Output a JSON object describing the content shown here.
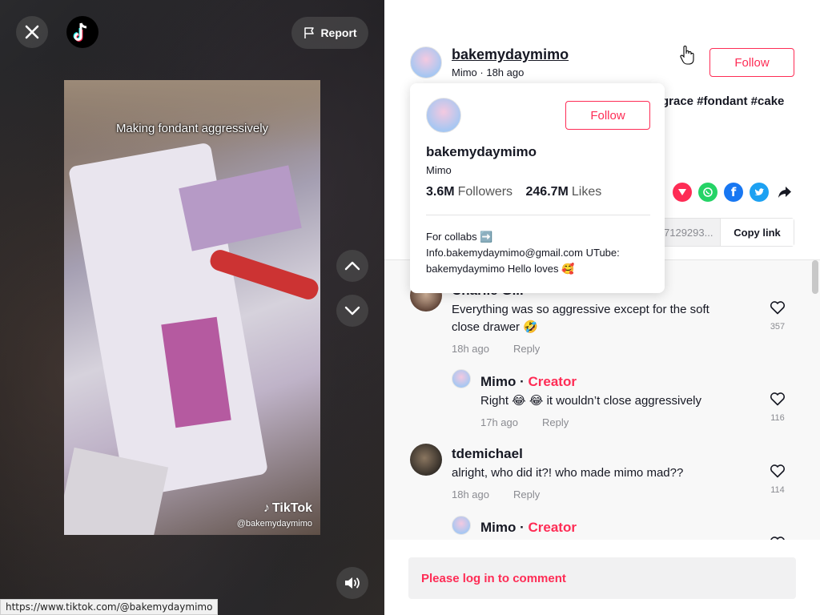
{
  "video": {
    "caption": "Making fondant aggressively",
    "watermark_brand": "TikTok",
    "watermark_handle": "@bakemydaymimo",
    "report_label": "Report"
  },
  "status_bar": {
    "url": "https://www.tiktok.com/@bakemydaymimo"
  },
  "author": {
    "username": "bakemydaymimo",
    "nickname": "Mimo",
    "posted": "18h ago",
    "follow_label": "Follow",
    "description_visible": "grace #fondant #cake"
  },
  "popover": {
    "username": "bakemydaymimo",
    "nickname": "Mimo",
    "follow_label": "Follow",
    "followers_count": "3.6M",
    "followers_label": "Followers",
    "likes_count": "246.7M",
    "likes_label": "Likes",
    "bio_line1": "For collabs ➡️",
    "bio_line2": "Info.bakemydaymimo@gmail.com UTube:",
    "bio_line3": "bakemydaymimo Hello loves 🥰"
  },
  "share": {
    "icons": [
      "pin-icon",
      "whatsapp-icon",
      "facebook-icon",
      "twitter-icon",
      "share-arrow-icon"
    ],
    "link_text": "7129293...",
    "copy_label": "Copy link"
  },
  "comments": [
    {
      "name": "Charlie Gill",
      "text": "Everything was so aggressive except for the soft close drawer 🤣",
      "time": "18h ago",
      "reply": "Reply",
      "likes": "357"
    },
    {
      "name": "Mimo",
      "creator": "Creator",
      "text": "Right 😂 😂 it wouldn’t close aggressively",
      "time": "17h ago",
      "reply": "Reply",
      "likes": "116"
    },
    {
      "name": "tdemichael",
      "text": "alright, who did it?! who made mimo mad??",
      "time": "18h ago",
      "reply": "Reply",
      "likes": "114"
    },
    {
      "name": "Mimo",
      "creator": "Creator"
    }
  ],
  "login_prompt": "Please log in to comment",
  "colors": {
    "accent": "#fe2c55",
    "text": "#161823",
    "muted": "#8a8b91"
  }
}
